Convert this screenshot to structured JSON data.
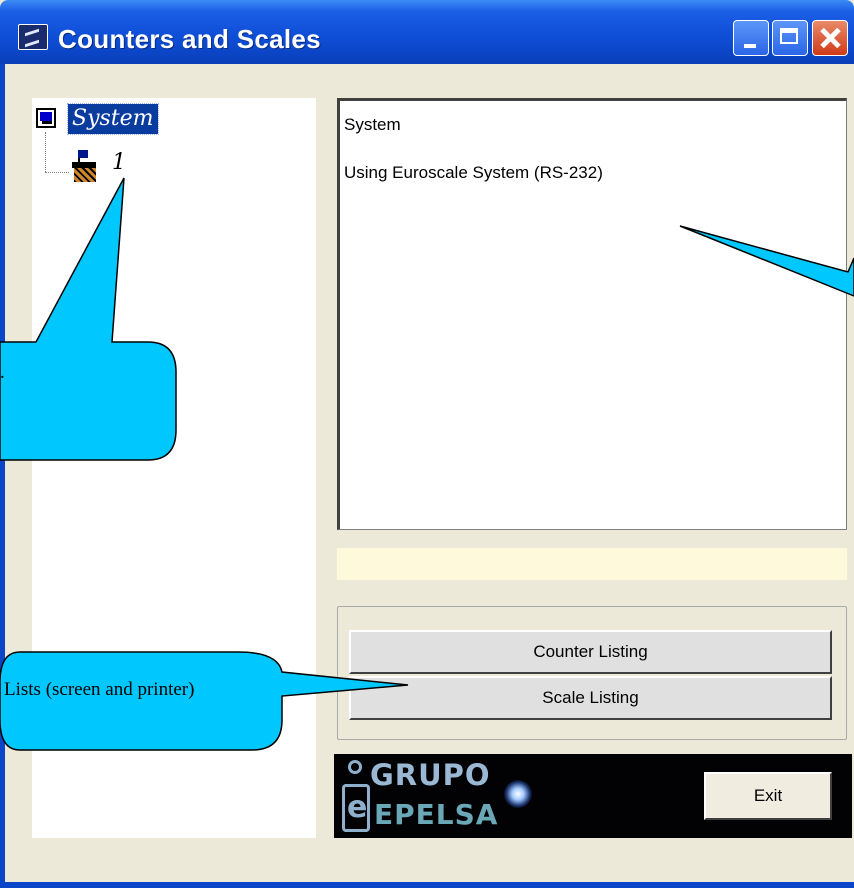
{
  "window": {
    "title": "Counters and Scales",
    "icon": "app-icon",
    "titlebar_color": "#0b46c8"
  },
  "tree": {
    "root": {
      "label": "System",
      "icon": "computer-icon"
    },
    "child": {
      "label": "1",
      "icon": "scale-icon"
    }
  },
  "info": {
    "line1": "System",
    "line2": "Using Euroscale System (RS-232)"
  },
  "status_bar": {
    "text": ""
  },
  "buttons": {
    "counter_listing": "Counter Listing",
    "scale_listing": "Scale Listing",
    "exit": "Exit"
  },
  "logo": {
    "line1": "GRUPO",
    "line2": "EPELSA"
  },
  "callouts": {
    "tree_note": ".",
    "lists_note": "Lists (screen and printer)",
    "fill_color": "#00c8ff"
  }
}
